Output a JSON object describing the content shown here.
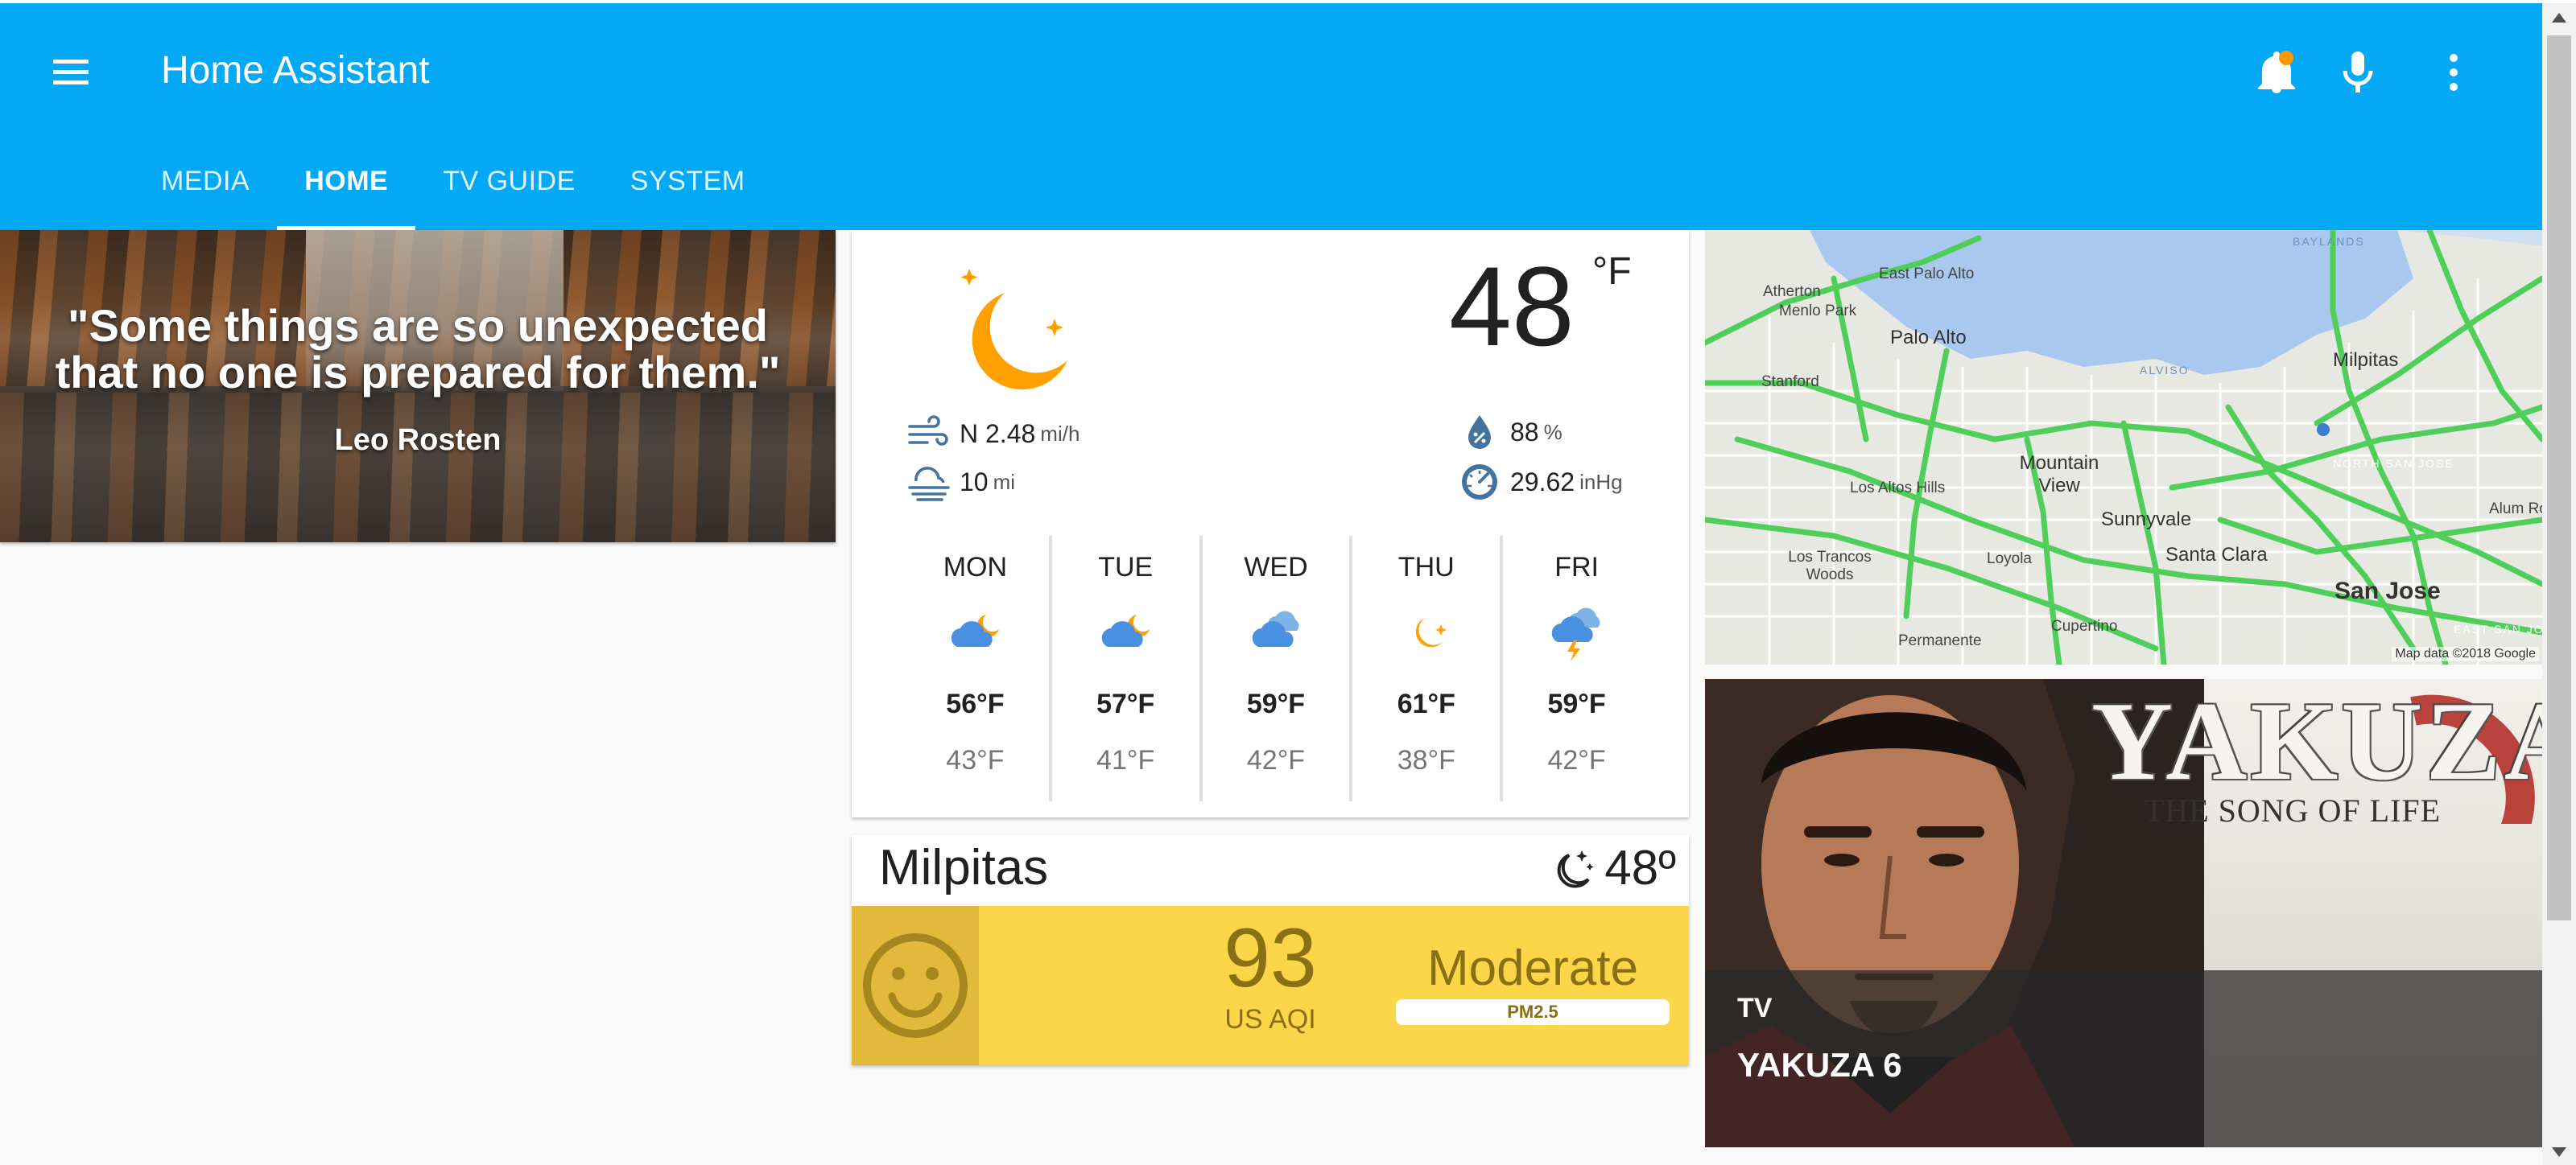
{
  "app": {
    "title": "Home Assistant"
  },
  "tabs": [
    {
      "label": "MEDIA",
      "active": false
    },
    {
      "label": "HOME",
      "active": true
    },
    {
      "label": "TV GUIDE",
      "active": false
    },
    {
      "label": "SYSTEM",
      "active": false
    }
  ],
  "header_icons": {
    "menu": "menu-icon",
    "notifications": "bell-icon",
    "voice": "microphone-icon",
    "overflow": "more-vert-icon"
  },
  "colors": {
    "accent": "#03a9f4",
    "notification_badge": "#ff9800",
    "aqi_moderate": "#fbd649",
    "traffic": "#4fcf5a"
  },
  "quote": {
    "text": "\"Some things are so unexpected that no one is prepared for them.\"",
    "author": "Leo Rosten"
  },
  "weather": {
    "condition_icon": "night-clear-moon-icon",
    "temperature": "48",
    "temperature_unit": "°F",
    "wind": {
      "value": "N 2.48",
      "unit": "mi/h"
    },
    "visibility": {
      "value": "10",
      "unit": "mi"
    },
    "humidity": {
      "value": "88",
      "unit": "%"
    },
    "pressure": {
      "value": "29.62",
      "unit": "inHg"
    },
    "forecast": [
      {
        "day": "MON",
        "icon": "partly-cloudy-night-icon",
        "high": "56°F",
        "low": "43°F"
      },
      {
        "day": "TUE",
        "icon": "partly-cloudy-night-icon",
        "high": "57°F",
        "low": "41°F"
      },
      {
        "day": "WED",
        "icon": "cloudy-icon",
        "high": "59°F",
        "low": "42°F"
      },
      {
        "day": "THU",
        "icon": "clear-night-icon",
        "high": "61°F",
        "low": "38°F"
      },
      {
        "day": "FRI",
        "icon": "thunderstorm-icon",
        "high": "59°F",
        "low": "42°F"
      }
    ]
  },
  "aqi": {
    "city": "Milpitas",
    "temperature": "48º",
    "value": "93",
    "label": "US AQI",
    "level": "Moderate",
    "pollutant": "PM2.5"
  },
  "map": {
    "labels": [
      "Palo Alto",
      "East Palo Alto",
      "Atherton",
      "Menlo Park",
      "Stanford",
      "Milpitas",
      "Mountain View",
      "Los Altos Hills",
      "Sunnyvale",
      "Loyola",
      "Santa Clara",
      "Los Trancos Woods",
      "San Jose",
      "Cupertino",
      "Permanente",
      "ALVISO",
      "NORTH SAN JOSE",
      "BAYLANDS",
      "Alum Rock",
      "EAST SAN JO"
    ],
    "attribution": "Map data ©2018 Google"
  },
  "media": {
    "logo_text": "YAKUZA",
    "subtitle": "THE SONG OF LIFE",
    "type": "TV",
    "title": "YAKUZA 6"
  }
}
